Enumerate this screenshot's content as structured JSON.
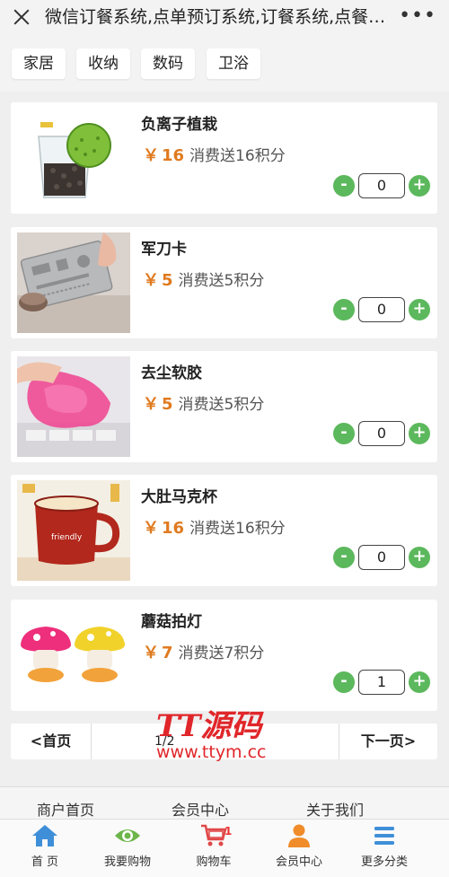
{
  "titlebar": {
    "title": "微信订餐系统,点单预订系统,订餐系统,点餐系统",
    "close_icon": "close-icon",
    "more_icon": "more-dots-icon"
  },
  "categories": [
    "家居",
    "收纳",
    "数码",
    "卫浴"
  ],
  "currency": "￥",
  "products": [
    {
      "name": "负离子植栽",
      "price": "16",
      "points": "消费送16积分",
      "qty": "0",
      "image": "plant-in-glass-image"
    },
    {
      "name": "军刀卡",
      "price": "5",
      "points": "消费送5积分",
      "qty": "0",
      "image": "multitool-card-image"
    },
    {
      "name": "去尘软胶",
      "price": "5",
      "points": "消费送5积分",
      "qty": "0",
      "image": "cleaning-gel-image"
    },
    {
      "name": "大肚马克杯",
      "price": "16",
      "points": "消费送16积分",
      "qty": "0",
      "image": "mug-image"
    },
    {
      "name": "蘑菇拍灯",
      "price": "7",
      "points": "消费送7积分",
      "qty": "1",
      "image": "mushroom-lamp-image"
    }
  ],
  "stepper": {
    "minus": "-",
    "plus": "+"
  },
  "pager": {
    "first": "<首页",
    "info": "1/2",
    "next": "下一页>"
  },
  "watermark": {
    "brand": "TT源码",
    "url": "www.ttym.cc"
  },
  "footer_links": [
    "商户首页",
    "会员中心",
    "关于我们"
  ],
  "bottom_nav": [
    {
      "label": "首 页",
      "icon": "home-icon"
    },
    {
      "label": "我要购物",
      "icon": "eye-icon"
    },
    {
      "label": "购物车",
      "icon": "cart-icon",
      "badge": "1"
    },
    {
      "label": "会员中心",
      "icon": "user-icon"
    },
    {
      "label": "更多分类",
      "icon": "menu-icon"
    }
  ],
  "colors": {
    "price": "#e07a1f",
    "stepper_button": "#5cb85c",
    "nav_blue": "#3f8fd8",
    "nav_green": "#6cb54a",
    "nav_red": "#e04848",
    "nav_orange": "#f08c2a"
  }
}
